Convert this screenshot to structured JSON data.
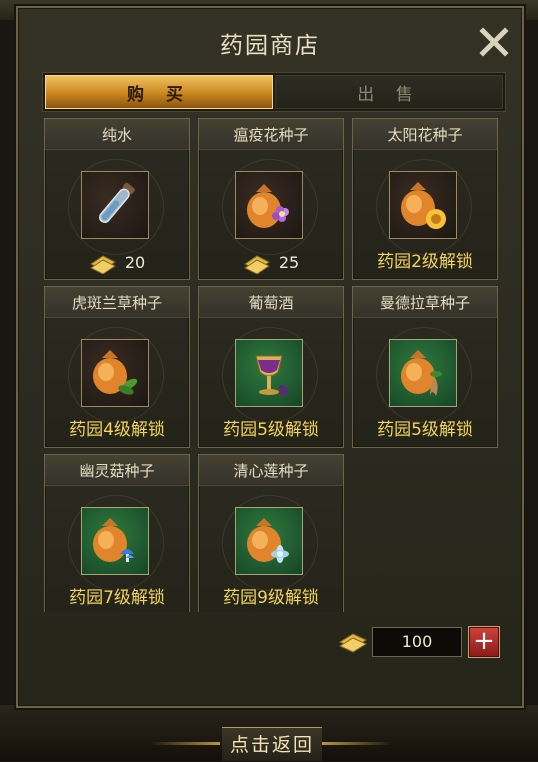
{
  "window": {
    "title": "药园商店"
  },
  "tabs": [
    {
      "label": "购 买",
      "active": true
    },
    {
      "label": "出 售",
      "active": false
    }
  ],
  "items": [
    {
      "name": "纯水",
      "icon": "water-vial-icon",
      "price": "20"
    },
    {
      "name": "瘟疫花种子",
      "icon": "plague-flower-seed-icon",
      "price": "25"
    },
    {
      "name": "太阳花种子",
      "icon": "sunflower-seed-icon",
      "unlock": "药园2级解锁"
    },
    {
      "name": "虎斑兰草种子",
      "icon": "tiger-orchid-seed-icon",
      "unlock": "药园4级解锁"
    },
    {
      "name": "葡萄酒",
      "icon": "wine-goblet-icon",
      "unlock": "药园5级解锁"
    },
    {
      "name": "曼德拉草种子",
      "icon": "mandrake-seed-icon",
      "unlock": "药园5级解锁"
    },
    {
      "name": "幽灵菇种子",
      "icon": "ghost-mushroom-seed-icon",
      "unlock": "药园7级解锁"
    },
    {
      "name": "清心莲种子",
      "icon": "lotus-seed-icon",
      "unlock": "药园9级解锁"
    }
  ],
  "purchase": {
    "quantity": "100",
    "plus_label": "+"
  },
  "footer": {
    "back_label": "点击返回"
  },
  "colors": {
    "accent_gold": "#c9861d",
    "unlock_text": "#f2d45a",
    "plus_red": "#d0433b"
  }
}
